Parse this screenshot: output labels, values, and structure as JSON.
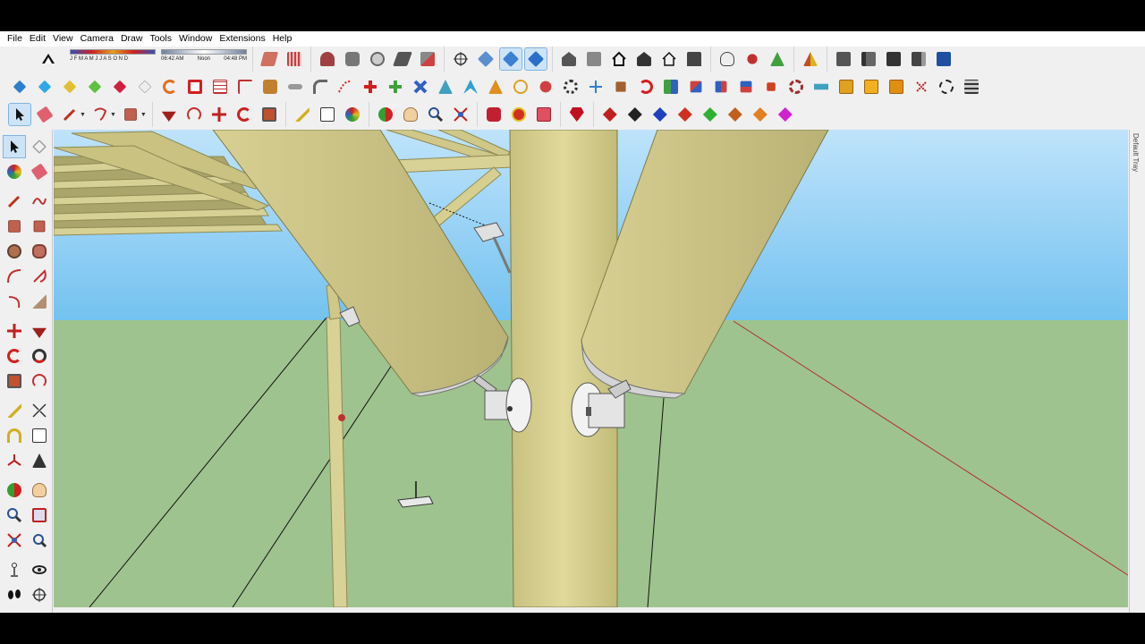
{
  "menu": [
    "File",
    "Edit",
    "View",
    "Camera",
    "Draw",
    "Tools",
    "Window",
    "Extensions",
    "Help"
  ],
  "shadow": {
    "months": "J F M A M J J A S O N D",
    "time_start": "06:42 AM",
    "time_noon": "Noon",
    "time_end": "04:48 PM"
  },
  "tray": {
    "label": "Default Tray"
  },
  "colors": {
    "sky_top": "#bfe3fb",
    "sky_bottom": "#73c2f0",
    "ground": "#9fc38e",
    "timber": "#d6cf8f",
    "timber_dark": "#b8b272",
    "red_axis": "#b03030",
    "toolbar_bg": "#f0f0f0"
  },
  "toolbars": {
    "row1": [
      [
        "styles-icon"
      ],
      [
        "shadow-settings-icon"
      ],
      [
        "sandbox-from-contours-icon",
        "sandbox-from-scratch-icon"
      ],
      [
        "smoove-icon",
        "stamp-icon",
        "drape-icon",
        "add-detail-icon",
        "flip-edge-icon"
      ],
      [
        "orbit-icon",
        "iso-view-icon",
        "top-view-icon",
        "front-view-icon"
      ],
      [
        "warehouse-icon",
        "extension-warehouse-icon",
        "home-view-icon",
        "back-view-icon",
        "left-view-icon",
        "house-icon"
      ],
      [
        "xray-icon",
        "back-edges-icon",
        "wireframe-icon"
      ],
      [
        "section-plane-icon"
      ],
      [
        "layers-icon",
        "outliner-icon",
        "components-icon",
        "materials-icon",
        "entity-info-icon"
      ]
    ],
    "row2": [
      "blue-cube-icon",
      "cyan-cube-icon",
      "yellow-face-icon",
      "green-face-icon",
      "red-face-icon",
      "white-face-icon",
      "follow-me-icon",
      "red-square-icon",
      "grid-icon",
      "flag-icon",
      "wood-icon",
      "pipe-icon",
      "arc-icon",
      "curve-icon",
      "cross-icon",
      "plus-green-icon",
      "blue-x-icon",
      "triangle-icon",
      "rotate-face-icon",
      "orange-triangle-icon",
      "lasso-icon",
      "paint-icon",
      "gear-icon",
      "move-blue-icon",
      "box-icon",
      "undo-red-icon",
      "component-icon",
      "cube-split-icon",
      "joint-icon",
      "joint-red-icon",
      "red-dot-icon",
      "snowflake-icon",
      "chart-icon",
      "crate-icon",
      "crate2-icon",
      "crate3-icon",
      "x-red-icon",
      "circle-dash-icon",
      "align-icon"
    ],
    "row3": [
      "select-icon",
      "eraser-icon",
      "pencil-icon",
      "lasso-draw-icon",
      "rectangle-icon",
      "push-pull-icon",
      "offset-icon",
      "move-icon",
      "rotate-icon",
      "scale-icon",
      "tape-measure-icon",
      "text-icon",
      "paint-bucket-icon",
      "orbit-tool-icon",
      "pan-icon",
      "zoom-icon",
      "zoom-extents-icon",
      "warehouse-red-icon",
      "extension-red-icon",
      "share-icon",
      "ruby-icon",
      "solid-tools-icon",
      "union-icon",
      "intersect-icon",
      "subtract-icon",
      "trim-icon",
      "split-icon",
      "outer-shell-icon",
      "magenta-icon"
    ]
  },
  "palette": [
    [
      "select-tool-icon",
      "component-tool-icon"
    ],
    [
      "paint-tool-icon",
      "eraser-tool-icon"
    ],
    [
      "line-tool-icon",
      "freehand-tool-icon"
    ],
    [
      "rectangle-tool-icon",
      "rotated-rect-icon"
    ],
    [
      "circle-tool-icon",
      "polygon-tool-icon"
    ],
    [
      "arc-tool-icon",
      "pie-tool-icon"
    ],
    [
      "arc3-tool-icon",
      "arc2-tool-icon"
    ],
    [
      "move-tool-icon",
      "push-pull-tool-icon"
    ],
    [
      "rotate-tool-icon",
      "follow-me-tool-icon"
    ],
    [
      "scale-tool-icon",
      "offset-tool-icon"
    ],
    [
      "tape-tool-icon",
      "dimension-tool-icon"
    ],
    [
      "protractor-tool-icon",
      "text-tool-icon"
    ],
    [
      "axes-tool-icon",
      "3dtext-tool-icon"
    ],
    [
      "orbit-palette-icon",
      "pan-palette-icon"
    ],
    [
      "zoom-palette-icon",
      "zoom-window-icon"
    ],
    [
      "zoom-extents-palette-icon",
      "previous-view-icon"
    ],
    [
      "position-camera-icon",
      "look-around-icon"
    ],
    [
      "walk-icon",
      "section-palette-icon"
    ]
  ]
}
